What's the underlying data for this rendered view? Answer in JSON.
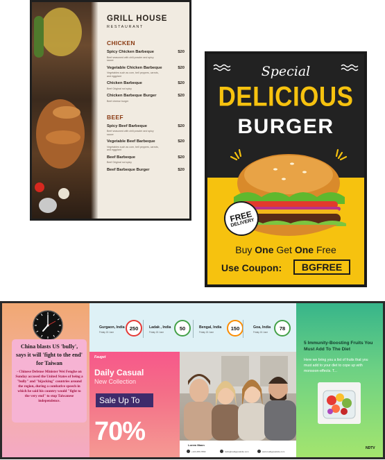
{
  "menu_board": {
    "title": "GRILL HOUSE",
    "subtitle": "RESTAURANT",
    "sections": [
      {
        "name": "CHICKEN",
        "items": [
          {
            "name": "Spicy Chicken Barbeque",
            "price": "$20",
            "desc": "Beef seasoned with chili powder and spicy sauce"
          },
          {
            "name": "Vegetable Chicken Barbeque",
            "price": "$20",
            "desc": "Vegetables such as corn, bell peppers, carrots, and eggplant"
          },
          {
            "name": "Chicken Barbeque",
            "price": "$20",
            "desc": "Beef Original not spicy"
          },
          {
            "name": "Chicken Barbeque Burger",
            "price": "$20",
            "desc": "Beef cheese burger"
          }
        ]
      },
      {
        "name": "BEEF",
        "items": [
          {
            "name": "Spicy Beef Barbeque",
            "price": "$20",
            "desc": "Beef seasoned with chili powder and spicy sauce"
          },
          {
            "name": "Vegetable Beef Barbeque",
            "price": "$20",
            "desc": "Vegetables such as corn, bell peppers, carrots, and eggplant"
          },
          {
            "name": "Beef Barbeque",
            "price": "$20",
            "desc": "Beef Original not spicy"
          },
          {
            "name": "Beef Barbeque Burger",
            "price": "$20",
            "desc": ""
          }
        ]
      }
    ]
  },
  "burger_poster": {
    "special": "Special",
    "headline": "DELICIOUS",
    "product": "BURGER",
    "badge_line1": "FREE",
    "badge_line2": "DELIVERY",
    "buy_1": "Buy ",
    "buy_2": "One",
    "buy_3": " Get ",
    "buy_4": "One",
    "buy_5": " Free",
    "coupon_label": "Use Coupon:",
    "coupon_code": "BGFREE",
    "colors": {
      "accent": "#f6c20f",
      "background": "#222222"
    }
  },
  "signage": {
    "news": {
      "headline": "China blasts US 'bully', says it will 'fight to the end' for Taiwan",
      "body": "- Chinese Defense Minister Wei Fenghe on Sunday accused the United States of being a \"bully\" and \"hijacking\" countries around the region, during a combative speech in which he said his country would \"fight to the very end\" to stop Taiwanese independence."
    },
    "weather": [
      {
        "city": "Gurgaon, India",
        "date": "Friday 15 June",
        "aqi": "250",
        "color": "#e53935"
      },
      {
        "city": "Ladak , India",
        "date": "Friday 15 June",
        "aqi": "50",
        "color": "#43a047"
      },
      {
        "city": "Bengal, India",
        "date": "Friday 15 June",
        "aqi": "150",
        "color": "#fb8c00"
      },
      {
        "city": "Goa, India",
        "date": "Friday 15 June",
        "aqi": "78",
        "color": "#43a047"
      }
    ],
    "promo": {
      "brand": "Fauget",
      "title": "Daily Casual",
      "subtitle": "New Collection",
      "sale": "Sale Up To",
      "percent": "70%"
    },
    "photo_footer": {
      "label": "Lorem Mann",
      "phone": "+123-456-7890",
      "email": "hello@reallygreatsite.com",
      "site": "www.reallygreatsite.com"
    },
    "health": {
      "title": "5 Immunity-Boosting Fruits You Must Add To The Diet",
      "text": "Here we bring you a list of fruits that you must add to your diet to cope up with monsoon-effects. T...",
      "source": "NDTV"
    }
  }
}
